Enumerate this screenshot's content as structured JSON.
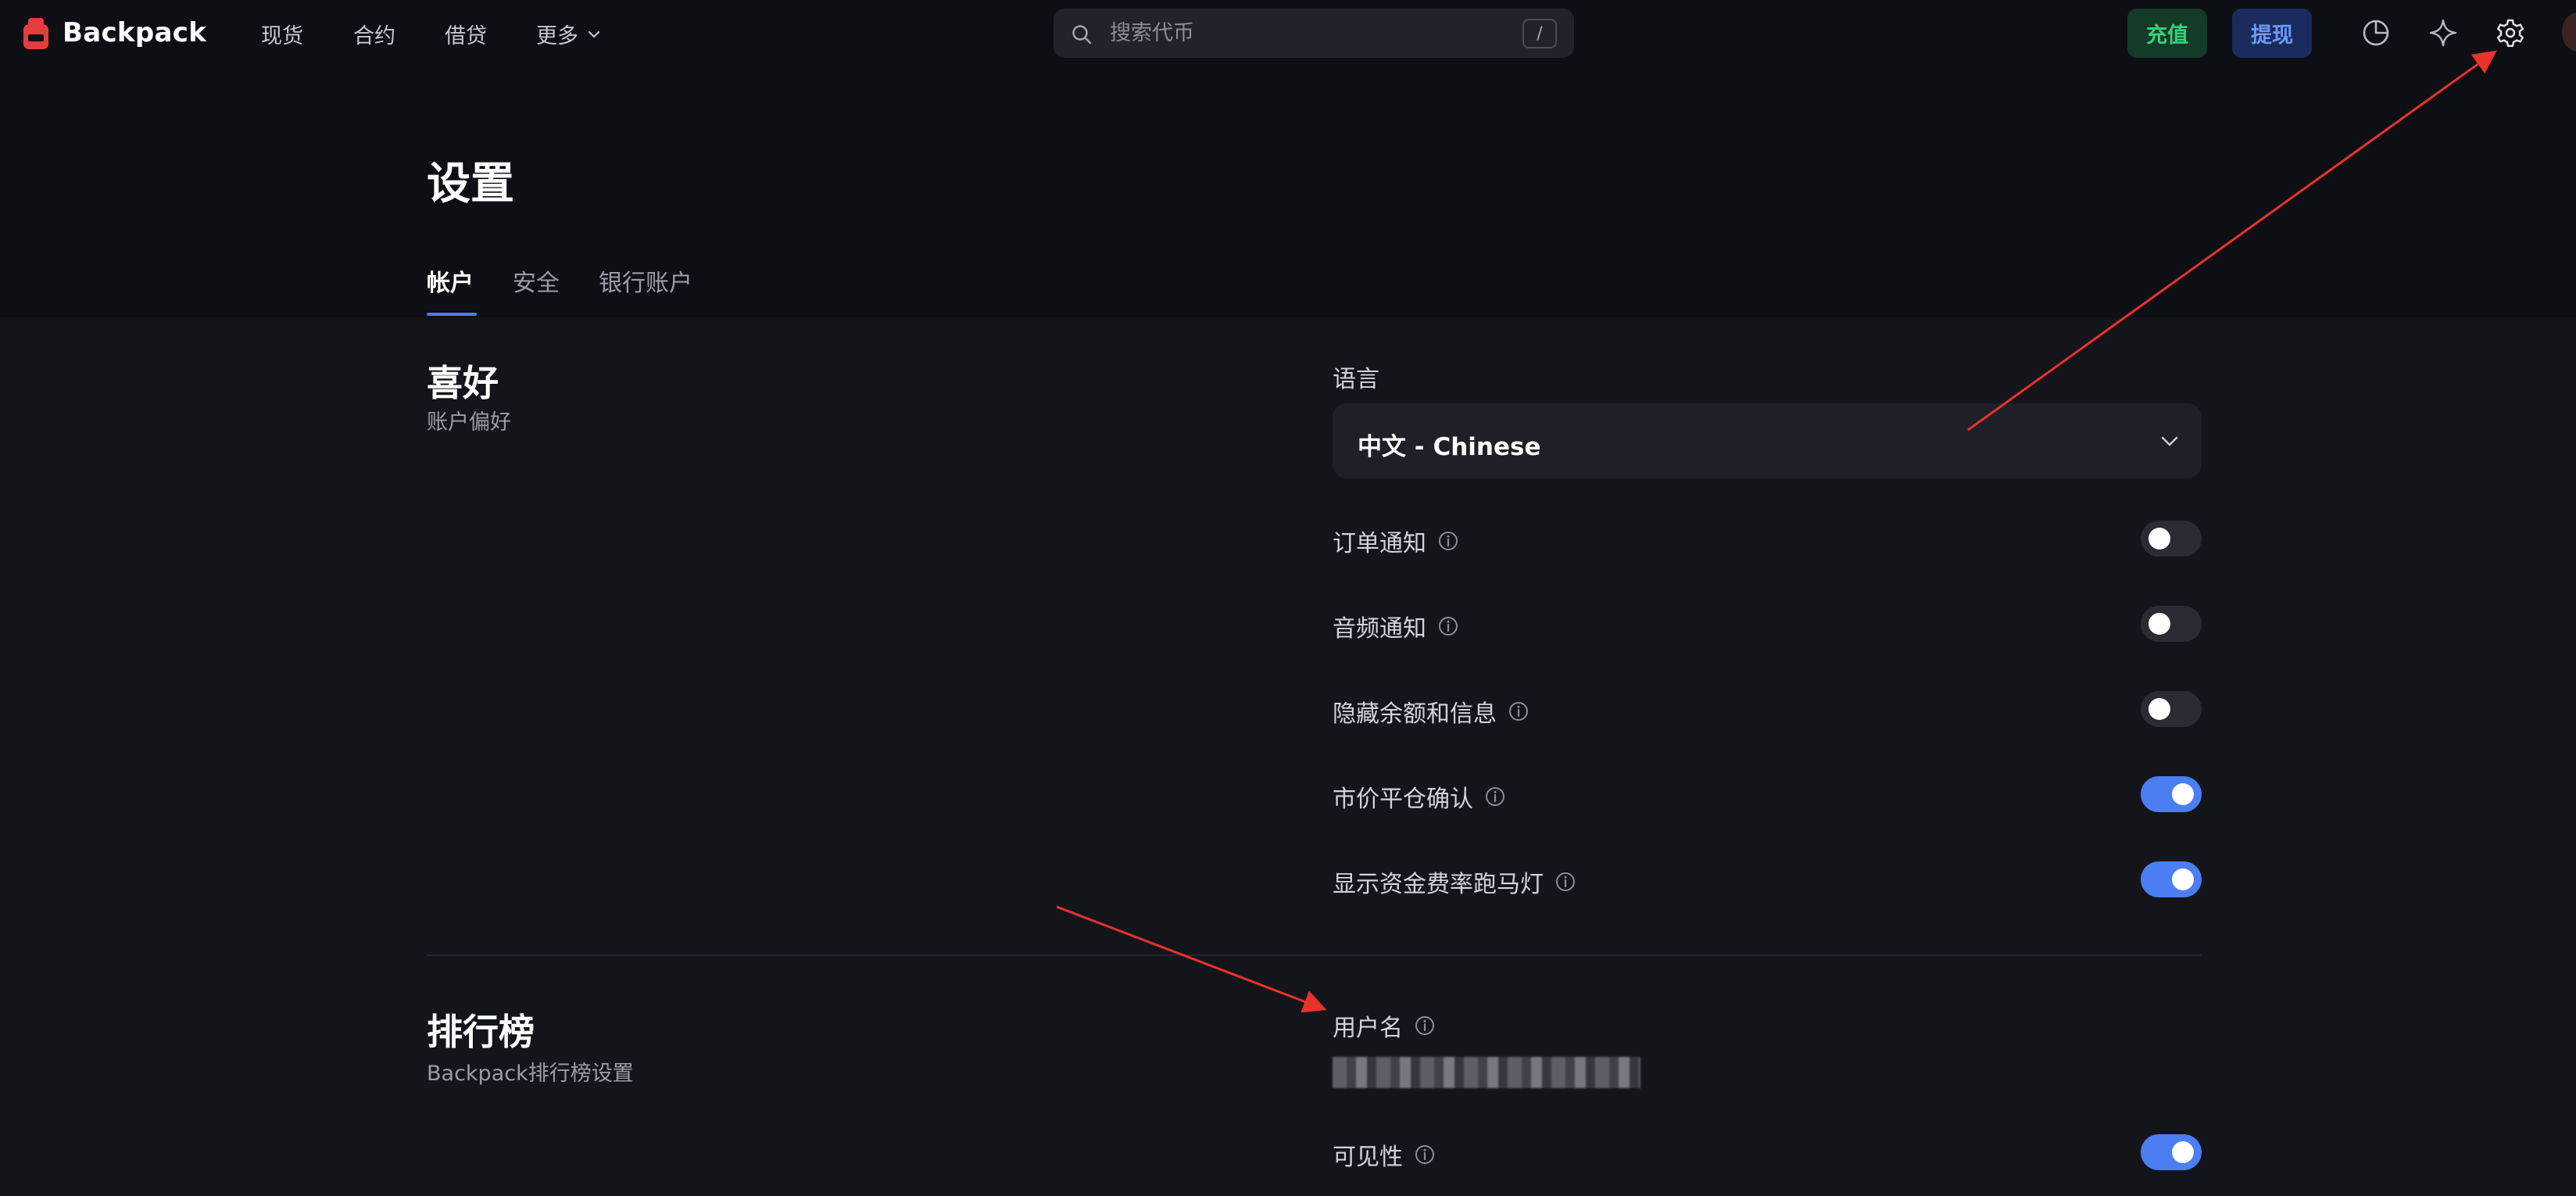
{
  "brand": {
    "name": "Backpack"
  },
  "nav": {
    "spot": "现货",
    "futures": "合约",
    "lend": "借贷",
    "more": "更多"
  },
  "search": {
    "placeholder": "搜索代币",
    "shortcut": "/"
  },
  "actions": {
    "deposit": "充值",
    "withdraw": "提现"
  },
  "page": {
    "title": "设置",
    "tabs": [
      "帐户",
      "安全",
      "银行账户"
    ],
    "active_tab": "帐户"
  },
  "preferences": {
    "title": "喜好",
    "subtitle": "账户偏好",
    "language_label": "语言",
    "language_value": "中文 - Chinese",
    "settings": [
      {
        "label": "订单通知",
        "enabled": false
      },
      {
        "label": "音频通知",
        "enabled": false
      },
      {
        "label": "隐藏余额和信息",
        "enabled": false
      },
      {
        "label": "市价平仓确认",
        "enabled": true
      },
      {
        "label": "显示资金费率跑马灯",
        "enabled": true
      }
    ]
  },
  "leaderboard": {
    "title": "排行榜",
    "subtitle": "Backpack排行榜设置",
    "username_label": "用户名",
    "visibility_label": "可见性",
    "visibility_enabled": true
  },
  "colors": {
    "background": "#14151b",
    "header_bg": "#0e0f14",
    "accent_blue": "#4b7ef2",
    "deposit_green": "#34d27a",
    "withdraw_blue": "#6c97ff",
    "annotation_red": "#e8322a"
  },
  "icons": [
    "backpack-logo-icon",
    "search-icon",
    "chevron-down-icon",
    "portfolio-pie-icon",
    "sparkle-icon",
    "gear-icon",
    "info-icon"
  ]
}
